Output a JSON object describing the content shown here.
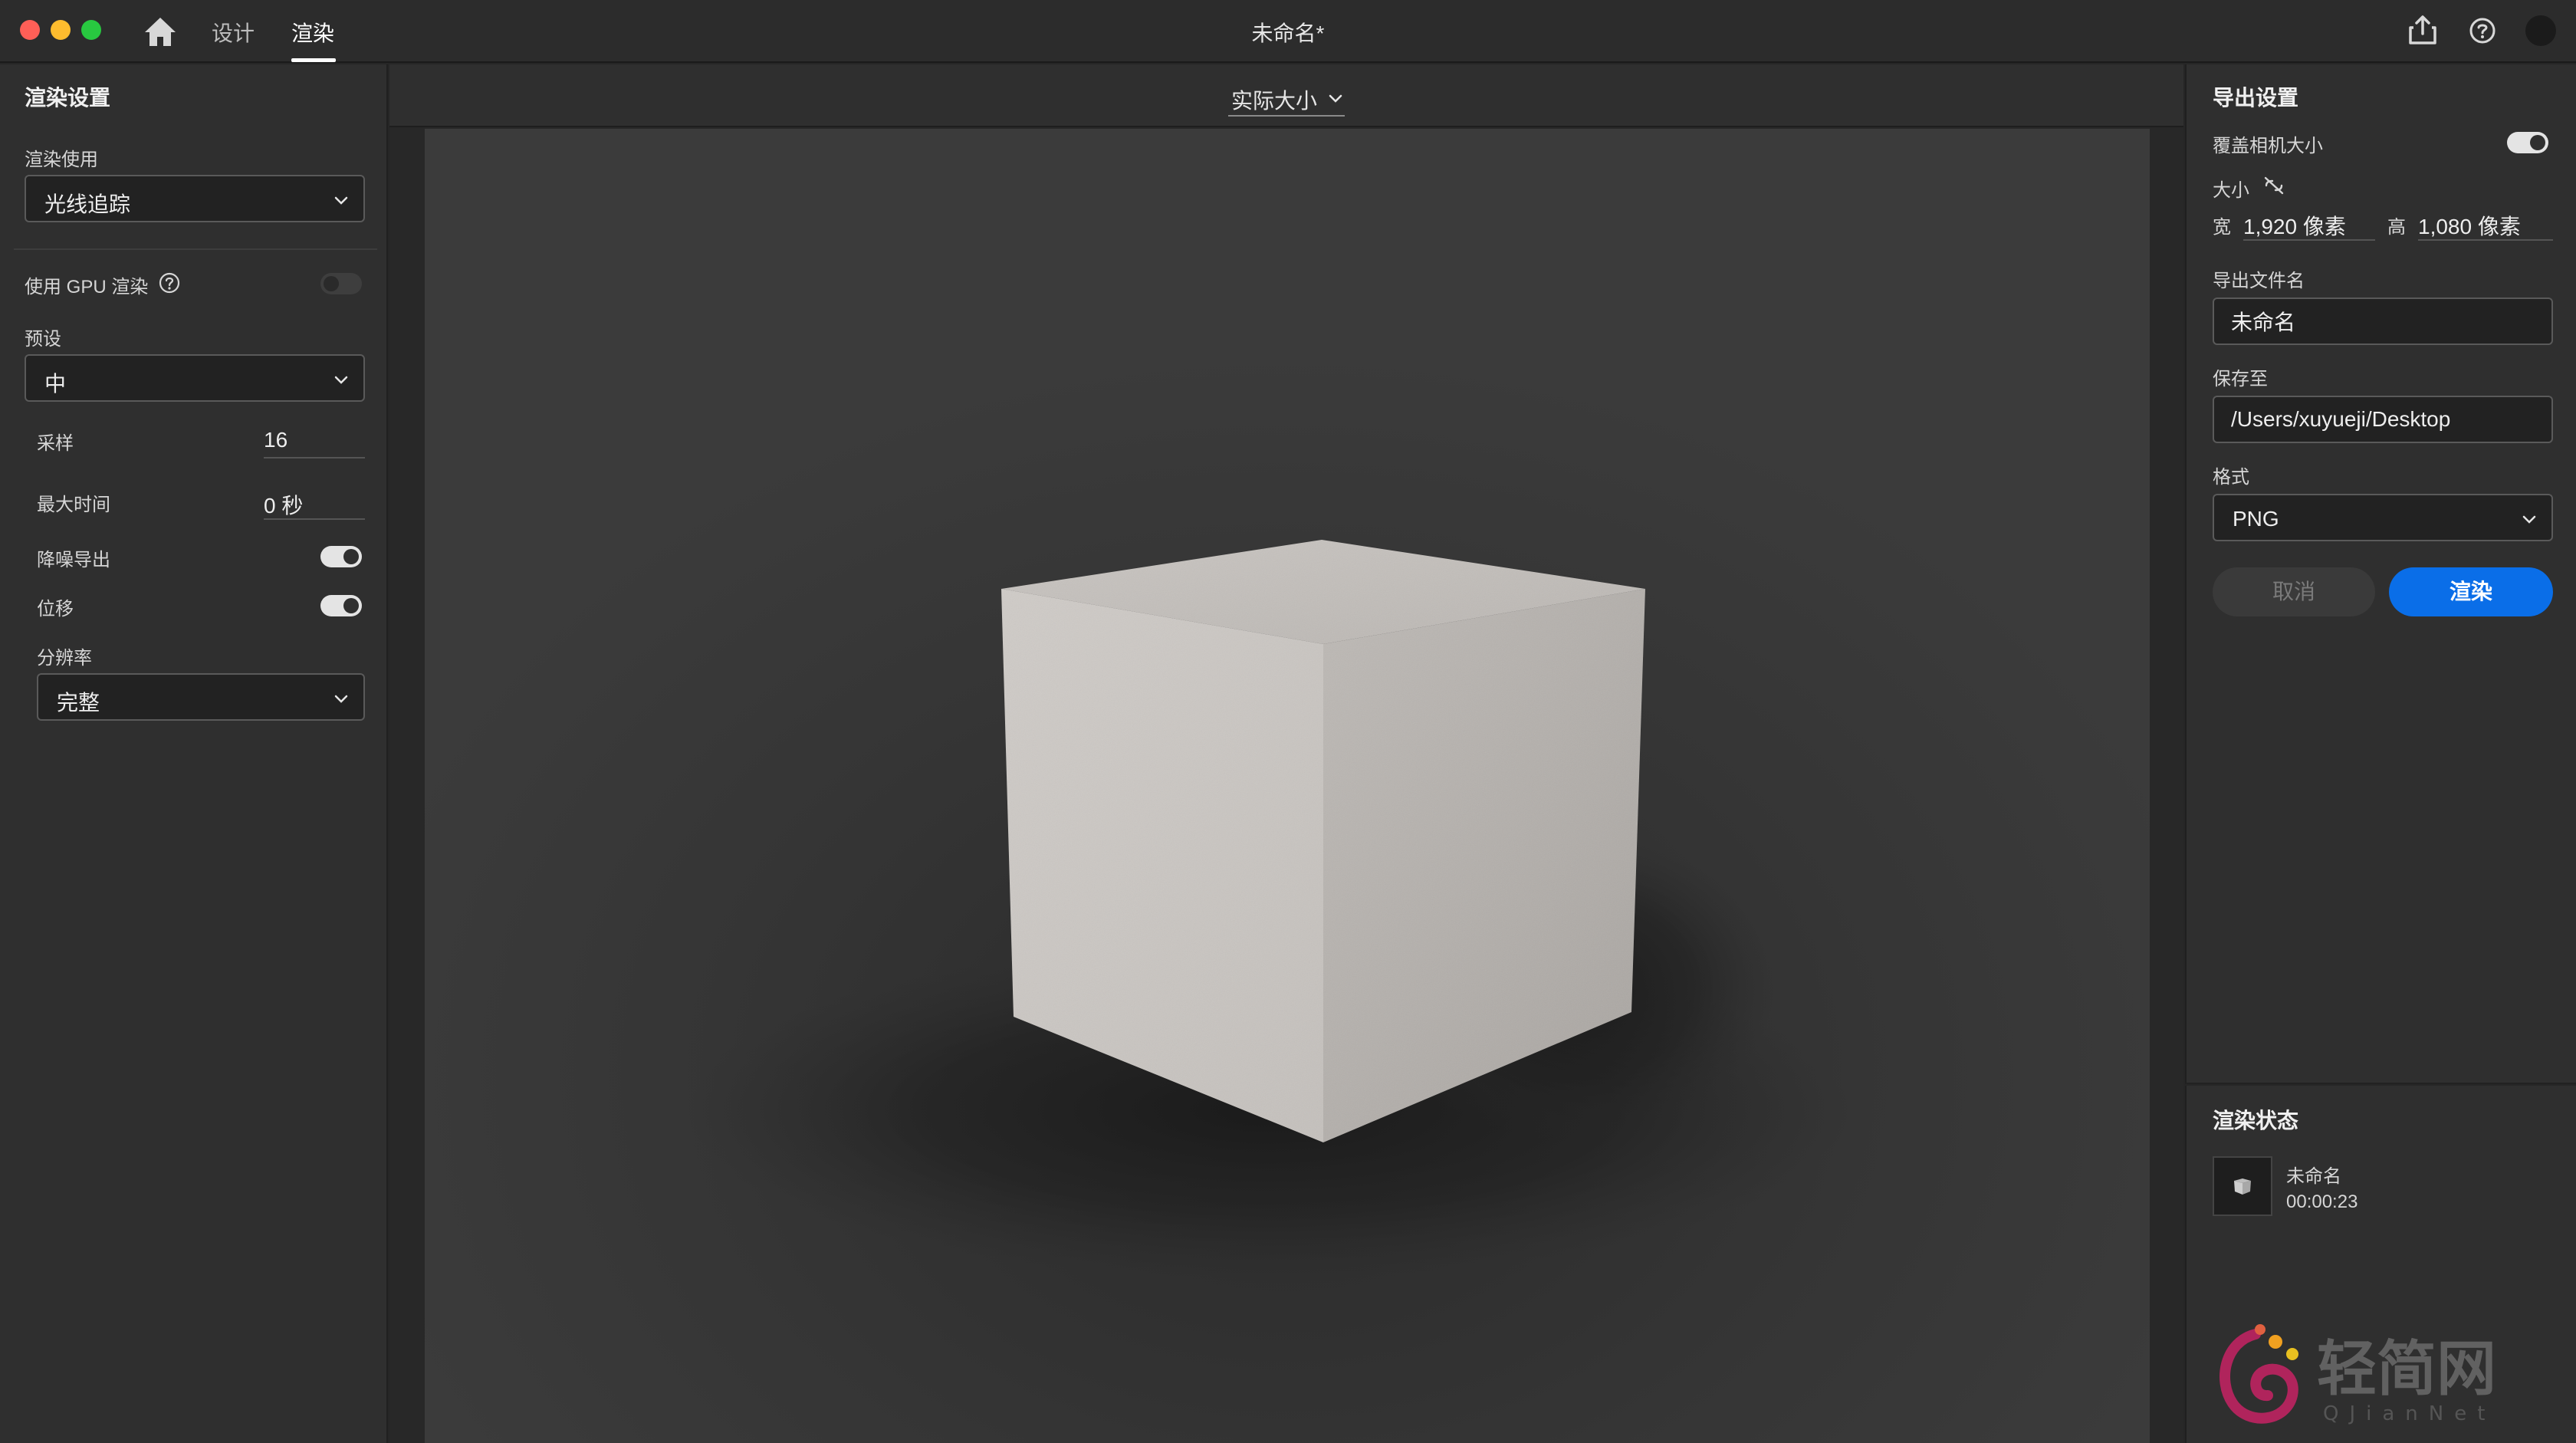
{
  "titlebar": {
    "tabs": [
      {
        "label": "设计",
        "active": false
      },
      {
        "label": "渲染",
        "active": true
      }
    ],
    "document_title": "未命名*"
  },
  "left": {
    "heading": "渲染设置",
    "render_using_label": "渲染使用",
    "render_using_value": "光线追踪",
    "gpu_label": "使用 GPU 渲染",
    "gpu_enabled": false,
    "preset_label": "预设",
    "preset_value": "中",
    "samples_label": "采样",
    "samples_value": "16",
    "max_time_label": "最大时间",
    "max_time_value": "0 秒",
    "denoise_label": "降噪导出",
    "denoise_enabled": true,
    "offset_label": "位移",
    "offset_enabled": true,
    "resolution_label": "分辨率",
    "resolution_value": "完整"
  },
  "center": {
    "zoom_label": "实际大小"
  },
  "right": {
    "heading": "导出设置",
    "override_camera_label": "覆盖相机大小",
    "override_camera_enabled": true,
    "size_label": "大小",
    "width_label": "宽",
    "width_value": "1,920 像素",
    "height_label": "高",
    "height_value": "1,080 像素",
    "filename_label": "导出文件名",
    "filename_value": "未命名",
    "save_to_label": "保存至",
    "save_to_value": "/Users/xuyueji/Desktop",
    "format_label": "格式",
    "format_value": "PNG",
    "cancel_label": "取消",
    "render_label": "渲染"
  },
  "status": {
    "heading": "渲染状态",
    "item_name": "未命名",
    "item_time": "00:00:23"
  },
  "watermark": {
    "text": "轻简网",
    "subtext": "QJianNet"
  },
  "colors": {
    "accent": "#0a6ee8",
    "panel": "#2f2f2f",
    "canvas": "#3a3a3a"
  },
  "icons": [
    "home-icon",
    "share-icon",
    "help-icon",
    "chevron-down-icon",
    "unlink-icon",
    "question-icon"
  ]
}
